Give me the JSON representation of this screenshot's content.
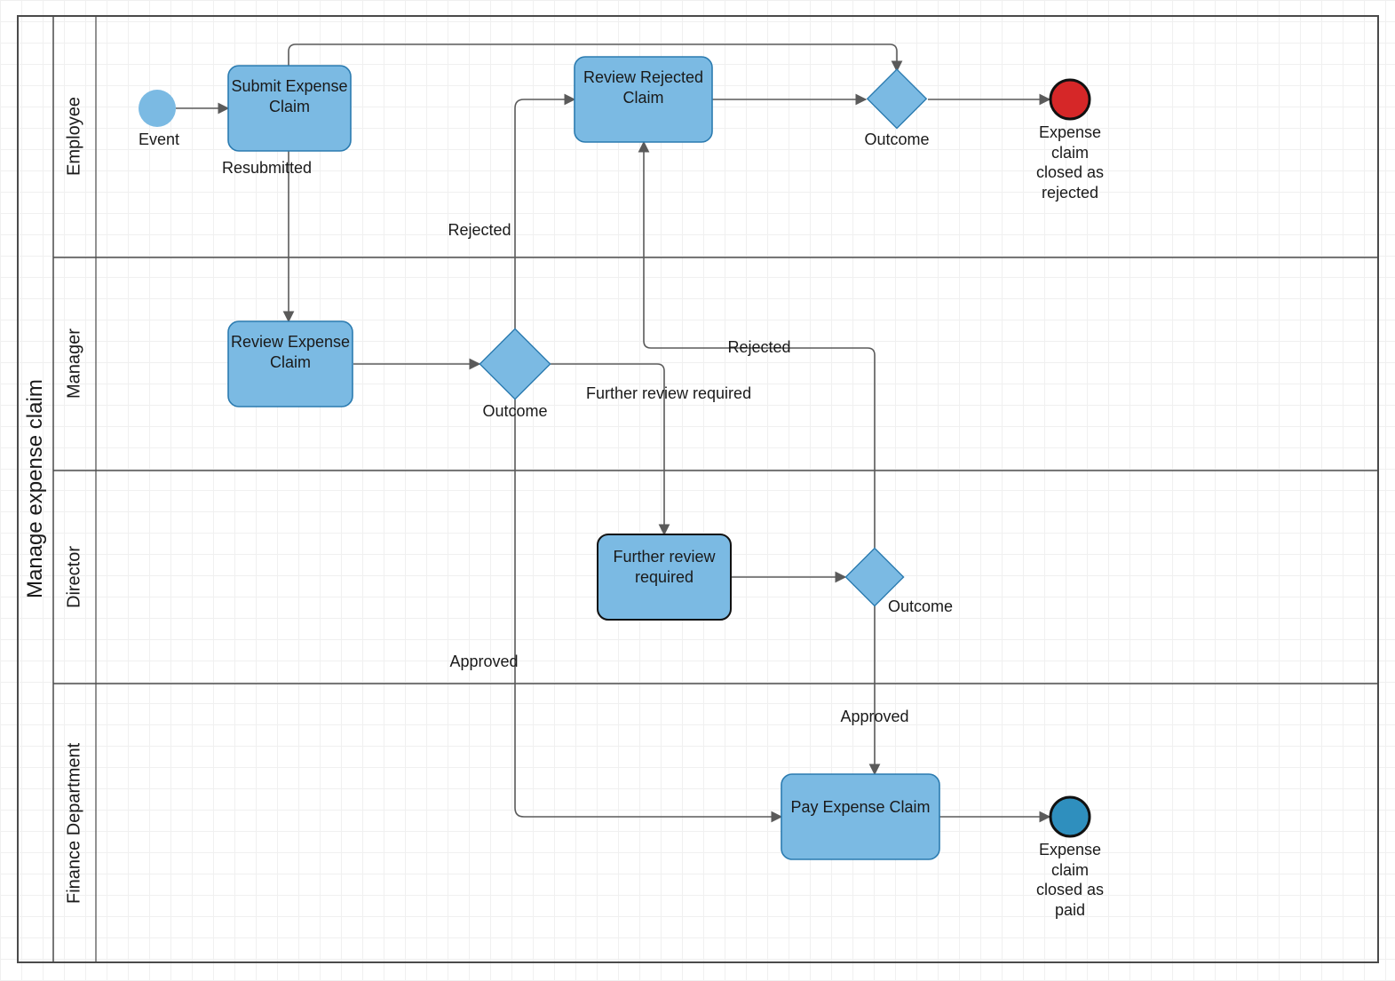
{
  "pool": {
    "title": "Manage expense claim"
  },
  "lanes": {
    "employee": "Employee",
    "manager": "Manager",
    "director": "Director",
    "finance": "Finance Department"
  },
  "events": {
    "start": "Event",
    "endRejected": "Expense claim closed as rejected",
    "endPaid": "Expense claim closed as paid"
  },
  "tasks": {
    "submit": "Submit Expense Claim",
    "reviewRejected": "Review Rejected Claim",
    "reviewExpense": "Review Expense Claim",
    "furtherReview": "Further review required",
    "pay": "Pay Expense Claim"
  },
  "gateways": {
    "employeeOutcome": "Outcome",
    "managerOutcome": "Outcome",
    "directorOutcome": "Outcome"
  },
  "edgeLabels": {
    "resubmitted": "Resubmitted",
    "rejectedToEmployee": "Rejected",
    "furtherReviewRequired": "Further review required",
    "approvedFromManager": "Approved",
    "rejectedFromDirector": "Rejected",
    "approvedFromDirector": "Approved"
  },
  "colors": {
    "shapeFill": "#7bbae3",
    "shapeStroke": "#000000",
    "redFill": "#d62728",
    "blueEndFill": "#2f8fbe",
    "line": "#5a5a5a"
  }
}
